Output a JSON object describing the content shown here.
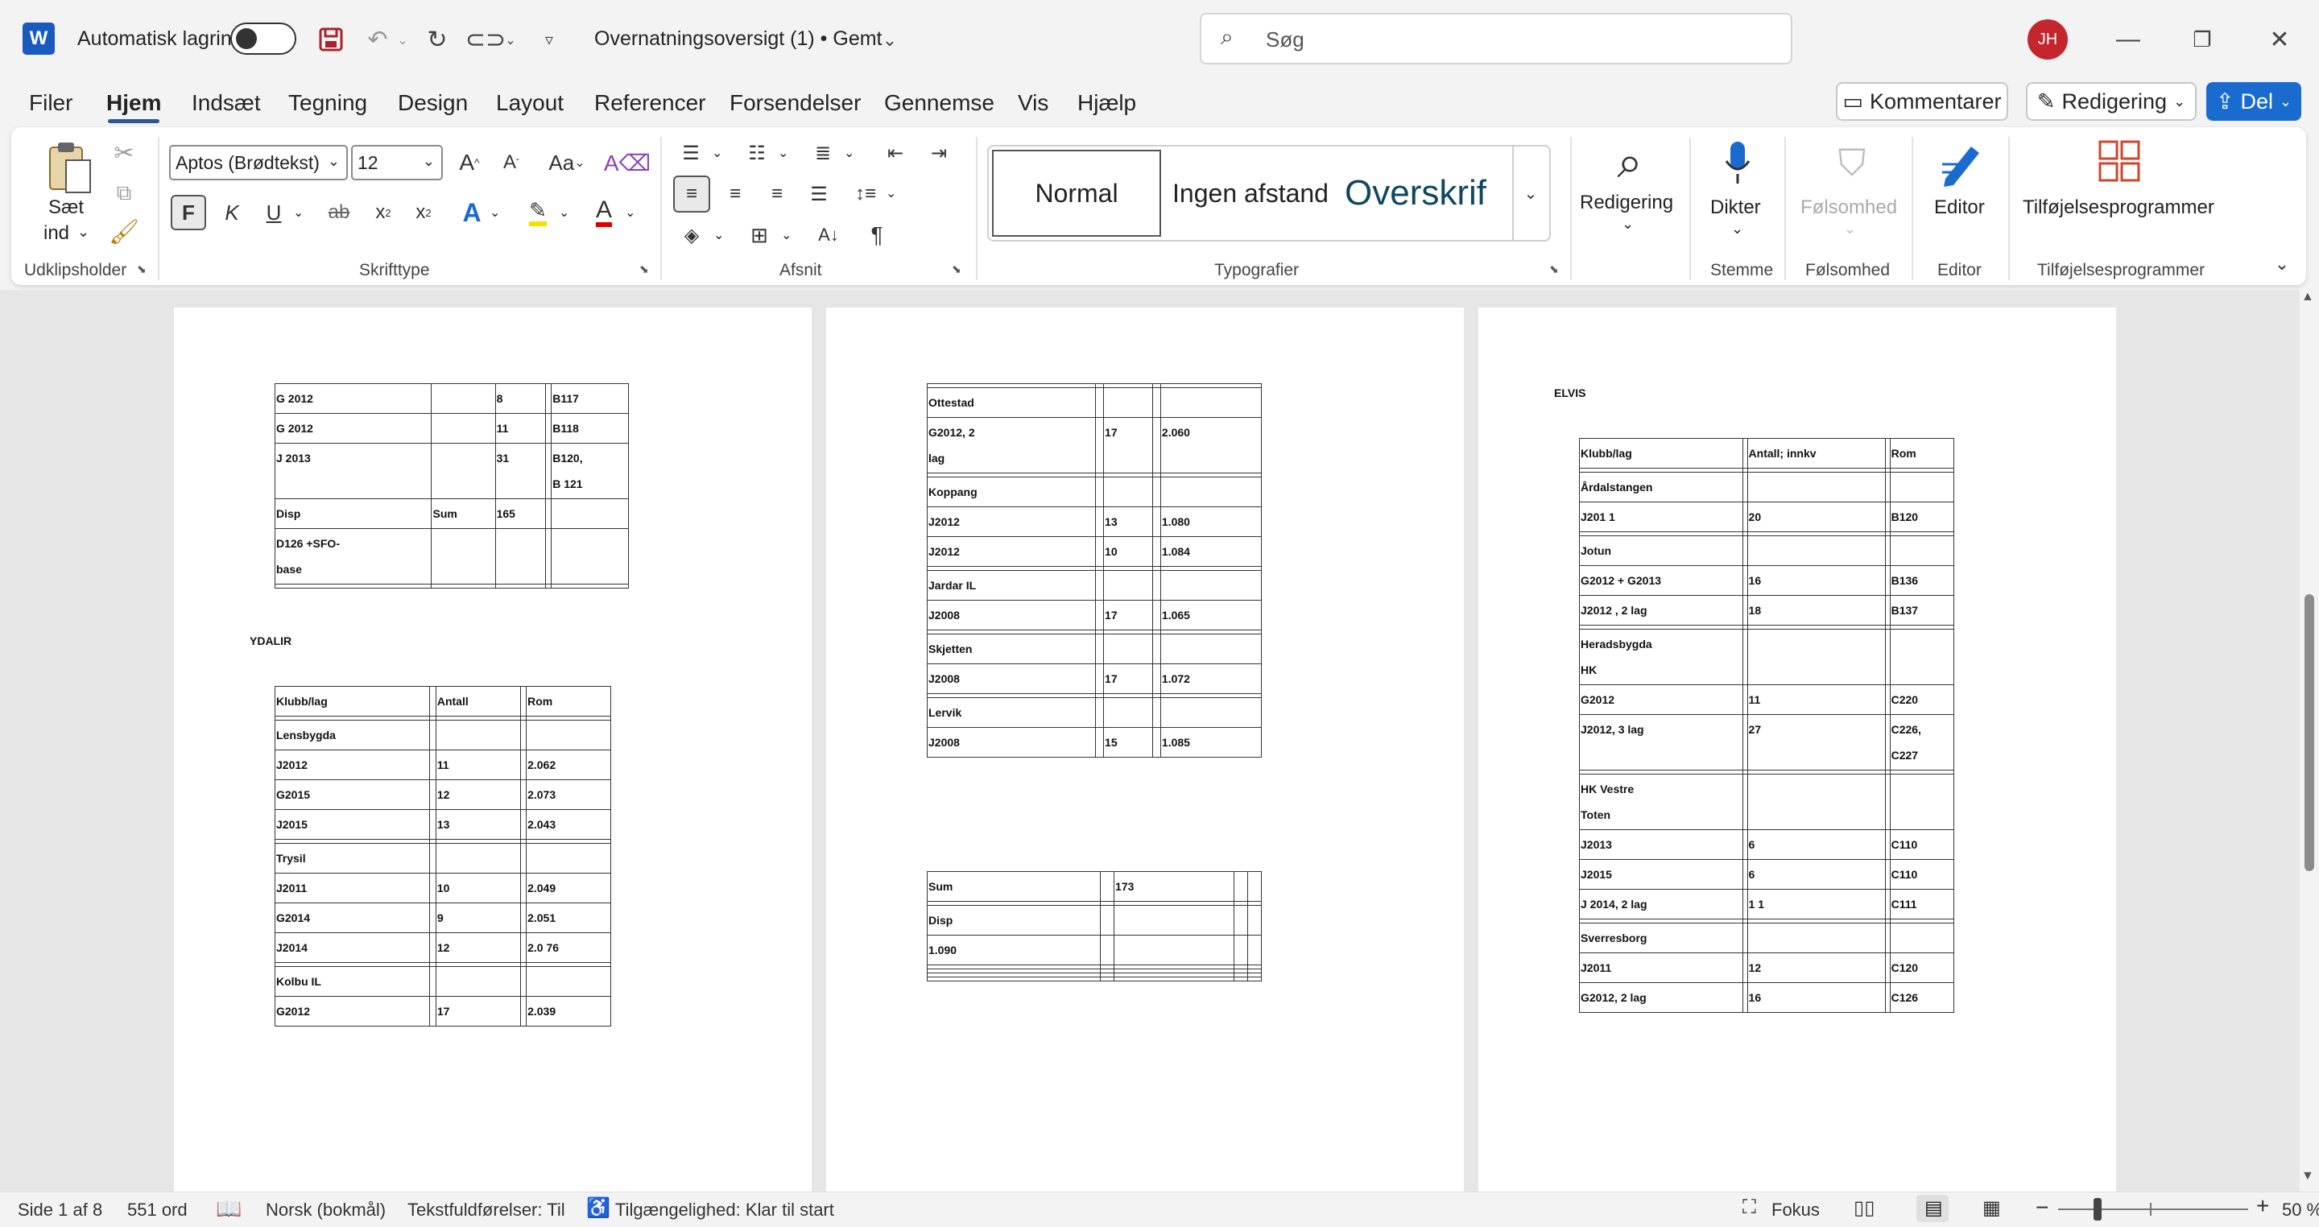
{
  "titlebar": {
    "autosave_label": "Automatisk lagring",
    "doc_title": "Overnatningsoversigt (1) • Gemt",
    "search_placeholder": "Søg",
    "avatar_initials": "JH"
  },
  "menu": {
    "items": [
      "Filer",
      "Hjem",
      "Indsæt",
      "Tegning",
      "Design",
      "Layout",
      "Referencer",
      "Forsendelser",
      "Gennemse",
      "Vis",
      "Hjælp"
    ],
    "active": "Hjem",
    "comments_label": "Kommentarer",
    "editing_label": "Redigering",
    "share_label": "Del"
  },
  "ribbon": {
    "paste_label_1": "Sæt",
    "paste_label_2": "ind",
    "font_name": "Aptos (Brødtekst)",
    "font_size": "12",
    "bold_label": "F",
    "italic_label": "K",
    "underline_label": "U",
    "styles": [
      "Normal",
      "Ingen afstand",
      "Overskrif"
    ],
    "editing_label": "Redigering",
    "dictate_label": "Dikter",
    "sensitivity_label": "Følsomhed",
    "editor_label": "Editor",
    "addins_label": "Tilføjelsesprogrammer",
    "groups": {
      "clipboard": "Udklipsholder",
      "font": "Skrifttype",
      "paragraph": "Afsnit",
      "styles": "Typografier",
      "voice": "Stemme",
      "sensitivity": "Følsomhed",
      "editor": "Editor",
      "addins": "Tilføjelsesprogrammer"
    }
  },
  "pages": {
    "page1": {
      "table1": [
        [
          "G 2012",
          "",
          "8",
          "",
          "B117"
        ],
        [
          "G 2012",
          "",
          "11",
          "",
          "B118"
        ],
        [
          "J 2013",
          "",
          "31",
          "",
          "B120,\nB 121"
        ],
        [
          "Disp",
          "Sum",
          "165",
          "",
          ""
        ],
        [
          "D126 +SFO-\nbase",
          "",
          "",
          "",
          ""
        ],
        [
          "",
          "",
          "",
          "",
          ""
        ]
      ],
      "heading": "YDALIR",
      "table2": [
        [
          "Klubb/lag",
          "",
          "Antall",
          "",
          "Rom"
        ],
        [
          "",
          "",
          "",
          "",
          ""
        ],
        [
          "Lensbygda",
          "",
          "",
          "",
          ""
        ],
        [
          "J2012",
          "",
          "11",
          "",
          "2.062"
        ],
        [
          "G2015",
          "",
          "12",
          "",
          "2.073"
        ],
        [
          "J2015",
          "",
          "13",
          "",
          "2.043"
        ],
        [
          "",
          "",
          "",
          "",
          ""
        ],
        [
          "Trysil",
          "",
          "",
          "",
          ""
        ],
        [
          "J2011",
          "",
          "10",
          "",
          "2.049"
        ],
        [
          "G2014",
          "",
          "9",
          "",
          "2.051"
        ],
        [
          "J2014",
          "",
          "12",
          "",
          "2.0     76"
        ],
        [
          "",
          "",
          "",
          "",
          ""
        ],
        [
          "Kolbu IL",
          "",
          "",
          "",
          ""
        ],
        [
          "G2012",
          "",
          "17",
          "",
          "2.039"
        ]
      ]
    },
    "page2": {
      "table1": [
        [
          "",
          "",
          "",
          "",
          ""
        ],
        [
          "Ottestad",
          "",
          "",
          "",
          ""
        ],
        [
          "G2012, 2\nlag",
          "",
          "17",
          "",
          "2.060"
        ],
        [
          "",
          "",
          "",
          "",
          ""
        ],
        [
          "Koppang",
          "",
          "",
          "",
          ""
        ],
        [
          "J2012",
          "",
          "13",
          "",
          "1.080"
        ],
        [
          "J2012",
          "",
          "10",
          "",
          "1.084"
        ],
        [
          "",
          "",
          "",
          "",
          ""
        ],
        [
          "Jardar IL",
          "",
          "",
          "",
          ""
        ],
        [
          "J2008",
          "",
          "17",
          "",
          "1.065"
        ],
        [
          "",
          "",
          "",
          "",
          ""
        ],
        [
          "Skjetten",
          "",
          "",
          "",
          ""
        ],
        [
          "J2008",
          "",
          "17",
          "",
          "1.072"
        ],
        [
          "",
          "",
          "",
          "",
          ""
        ],
        [
          "Lervik",
          "",
          "",
          "",
          ""
        ],
        [
          "J2008",
          "",
          "15",
          "",
          "1.085"
        ]
      ],
      "table2": [
        [
          "Sum",
          "",
          "173",
          "",
          ""
        ],
        [
          "",
          "",
          "",
          "",
          ""
        ],
        [
          "Disp",
          "",
          "",
          "",
          ""
        ],
        [
          "1.090",
          "",
          "",
          "",
          ""
        ],
        [
          "",
          "",
          "",
          "",
          ""
        ],
        [
          "",
          "",
          "",
          "",
          ""
        ],
        [
          "",
          "",
          "",
          "",
          ""
        ],
        [
          "",
          "",
          "",
          "",
          ""
        ]
      ]
    },
    "page3": {
      "heading": "ELVIS",
      "table1": [
        [
          "Klubb/lag",
          "",
          "Antall; innkv",
          "",
          "Rom"
        ],
        [
          "",
          "",
          "",
          "",
          ""
        ],
        [
          "Årdalstangen",
          "",
          "",
          "",
          ""
        ],
        [
          "J201    1",
          "",
          "20",
          "",
          "B120"
        ],
        [
          "",
          "",
          "",
          "",
          ""
        ],
        [
          "Jotun",
          "",
          "",
          "",
          ""
        ],
        [
          "G2012 + G2013",
          "",
          "16",
          "",
          "B136"
        ],
        [
          "J2012  , 2 lag",
          "",
          "18",
          "",
          "B137"
        ],
        [
          "",
          "",
          "",
          "",
          ""
        ],
        [
          "Heradsbygda\nHK",
          "",
          "",
          "",
          ""
        ],
        [
          "G2012",
          "",
          "11",
          "",
          "C220"
        ],
        [
          "J2012, 3 lag",
          "",
          "27",
          "",
          "C226,\nC227"
        ],
        [
          "",
          "",
          "",
          "",
          ""
        ],
        [
          "HK Vestre\nToten",
          "",
          "",
          "",
          ""
        ],
        [
          "J2013",
          "",
          "6",
          "",
          "C110"
        ],
        [
          "J2015",
          "",
          "6",
          "",
          "C110"
        ],
        [
          "J 2014, 2 lag",
          "",
          "1 1",
          "",
          "C111"
        ],
        [
          "",
          "",
          "",
          "",
          ""
        ],
        [
          "Sverresborg",
          "",
          "",
          "",
          ""
        ],
        [
          "J2011",
          "",
          "12",
          "",
          "C120"
        ],
        [
          "G2012, 2 lag",
          "",
          "16",
          "",
          "C126"
        ]
      ]
    }
  },
  "statusbar": {
    "page_info": "Side 1 af 8",
    "word_count": "551 ord",
    "language": "Norsk (bokmål)",
    "text_predictions": "Tekstfuldførelser: Til",
    "accessibility": "Tilgængelighed: Klar til start",
    "focus_label": "Fokus",
    "zoom_level": "50 %",
    "zoom_fraction": 0.5
  }
}
